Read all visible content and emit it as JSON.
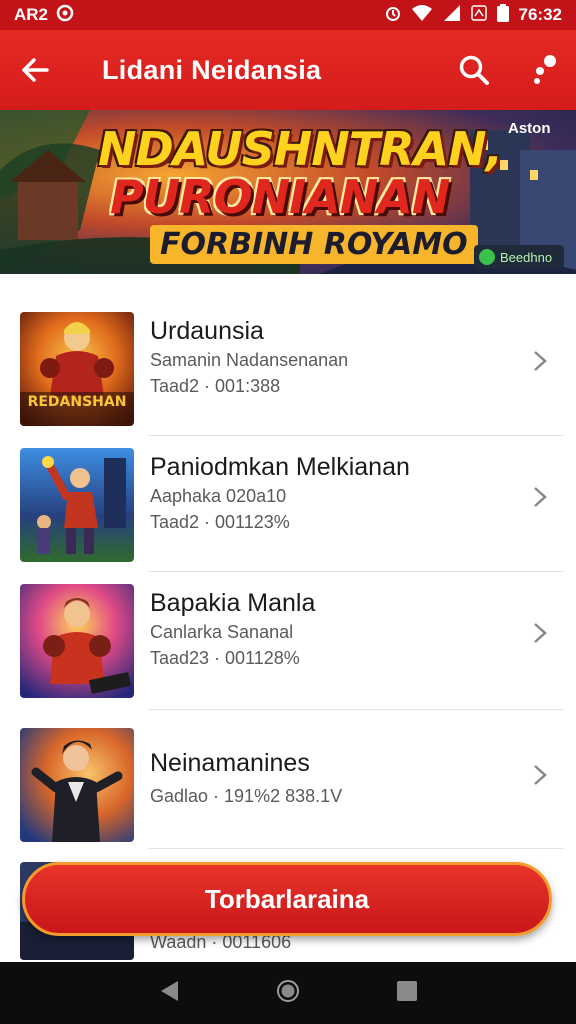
{
  "status_bar": {
    "left_text": "AR2",
    "time": "76:32",
    "icons": [
      "notification-icon",
      "alarm-icon",
      "wifi-icon",
      "signal-icon",
      "data-icon",
      "battery-icon"
    ]
  },
  "app_bar": {
    "title": "Lidani Neidansia",
    "icons": [
      "back-arrow-icon",
      "search-icon",
      "more-icon"
    ]
  },
  "banner": {
    "line1": "NDAUSHNTRAN,",
    "line2": "PURONIANAN",
    "line3": "FORBINH ROYAMO",
    "corner_text": "Aston",
    "badge_text": "Beedhno"
  },
  "list": {
    "items": [
      {
        "title": "Urdaunsia",
        "subtitle": "Samanin Nadansenanan",
        "meta": "Taad2 · 001:388",
        "thumb_caption": "REDANSHAN",
        "thumb_colors": [
          "#f08a1c",
          "#7a1f12"
        ]
      },
      {
        "title": "Paniodmkan Melkianan",
        "subtitle": "Aaphaka 020a10",
        "meta": "Taad2 · 001123%",
        "thumb_caption": "",
        "thumb_colors": [
          "#2f7bd6",
          "#1d2b5e"
        ]
      },
      {
        "title": "Bapakia Manla",
        "subtitle": "Canlarka Sananal",
        "meta": "Taad23 · 001128%",
        "thumb_caption": "",
        "thumb_colors": [
          "#e04a86",
          "#2b2f84"
        ]
      },
      {
        "title": "Neinamanines",
        "subtitle": "Gadlao · 191%2 838.1V",
        "meta": "",
        "thumb_caption": "",
        "thumb_colors": [
          "#f2a14b",
          "#243a80"
        ]
      },
      {
        "title": "",
        "subtitle": "",
        "meta": "Waadn · 0011606",
        "thumb_caption": "",
        "thumb_colors": [
          "#3a4a78",
          "#1a1f36"
        ]
      }
    ]
  },
  "primary_button": {
    "label": "Torbarlaraina"
  },
  "nav_bar": {
    "icons": [
      "back-triangle-icon",
      "home-circle-icon",
      "recents-square-icon"
    ]
  },
  "colors": {
    "brand_red": "#d41c1b",
    "accent_orange": "#f39a2a"
  }
}
